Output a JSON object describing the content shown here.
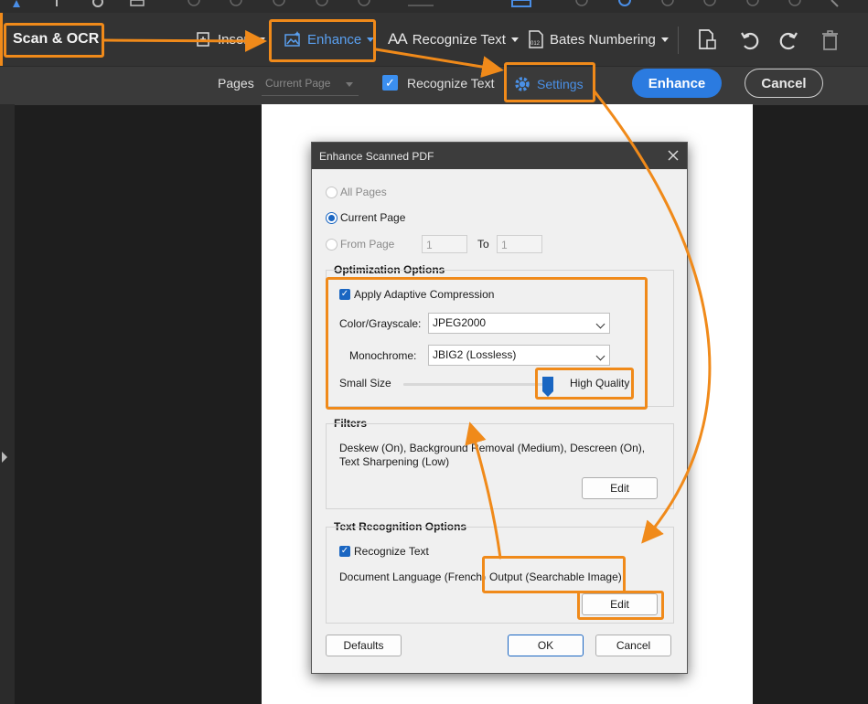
{
  "toolbar": {
    "mode_label": "Scan & OCR",
    "insert_label": "Insert",
    "enhance_label": "Enhance",
    "recognize_label": "Recognize Text",
    "bates_label": "Bates Numbering"
  },
  "subbar": {
    "pages_label": "Pages",
    "pages_value": "Current Page",
    "recognize_label": "Recognize Text",
    "settings_label": "Settings",
    "enhance_button": "Enhance",
    "cancel_button": "Cancel"
  },
  "dialog": {
    "title": "Enhance Scanned PDF",
    "all_pages": "All Pages",
    "current_page": "Current Page",
    "from_page": "From Page",
    "from_value": "1",
    "to_label": "To",
    "to_value": "1",
    "optimization": {
      "heading": "Optimization Options",
      "adaptive": "Apply Adaptive Compression",
      "color_label": "Color/Grayscale:",
      "color_value": "JPEG2000",
      "mono_label": "Monochrome:",
      "mono_value": "JBIG2 (Lossless)",
      "small_size": "Small Size",
      "high_quality": "High Quality",
      "quality_level": 1.0
    },
    "filters": {
      "heading": "Filters",
      "description": "Deskew (On), Background Removal (Medium), Descreen (On), Text Sharpening (Low)",
      "edit": "Edit"
    },
    "text_recognition": {
      "heading": "Text Recognition Options",
      "recognize": "Recognize Text",
      "language": "Document Language (French)",
      "output": "Output (Searchable Image)",
      "edit": "Edit"
    },
    "buttons": {
      "defaults": "Defaults",
      "ok": "OK",
      "cancel": "Cancel"
    }
  },
  "colors": {
    "highlight": "#f08a1a",
    "accent": "#1a66c2",
    "enhance_button": "#2b7be0"
  }
}
